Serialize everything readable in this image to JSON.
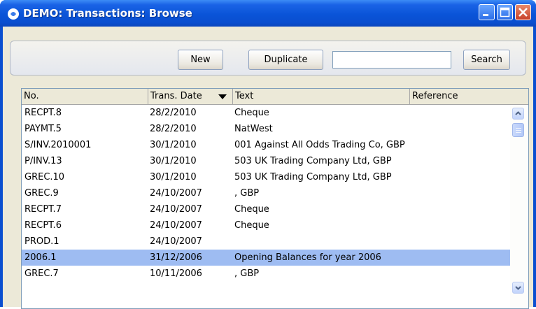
{
  "window": {
    "title": "DEMO: Transactions: Browse",
    "icons": [
      "app-icon",
      "minimize-icon",
      "maximize-icon",
      "close-icon"
    ]
  },
  "toolbar": {
    "new_label": "New",
    "duplicate_label": "Duplicate",
    "search_value": "",
    "search_label": "Search"
  },
  "table": {
    "columns": [
      "No.",
      "Trans. Date",
      "Text",
      "Reference"
    ],
    "sort_column": "Trans. Date",
    "rows": [
      {
        "no": "RECPT.8",
        "date": "28/2/2010",
        "text": "Cheque",
        "ref": ""
      },
      {
        "no": "PAYMT.5",
        "date": "28/2/2010",
        "text": "NatWest",
        "ref": ""
      },
      {
        "no": "S/INV.2010001",
        "date": "30/1/2010",
        "text": "001 Against All Odds Trading Co, GBP",
        "ref": ""
      },
      {
        "no": "P/INV.13",
        "date": "30/1/2010",
        "text": "503 UK Trading Company Ltd, GBP",
        "ref": ""
      },
      {
        "no": "GREC.10",
        "date": "30/1/2010",
        "text": "503 UK Trading Company Ltd, GBP",
        "ref": ""
      },
      {
        "no": "GREC.9",
        "date": "24/10/2007",
        "text": ", GBP",
        "ref": ""
      },
      {
        "no": "RECPT.7",
        "date": "24/10/2007",
        "text": "Cheque",
        "ref": ""
      },
      {
        "no": "RECPT.6",
        "date": "24/10/2007",
        "text": "Cheque",
        "ref": ""
      },
      {
        "no": "PROD.1",
        "date": "24/10/2007",
        "text": "",
        "ref": ""
      },
      {
        "no": "2006.1",
        "date": "31/12/2006",
        "text": "Opening Balances for year 2006",
        "ref": ""
      },
      {
        "no": "GREC.7",
        "date": "10/11/2006",
        "text": ", GBP",
        "ref": ""
      }
    ],
    "selected_row": 9
  },
  "colors": {
    "titlebar": "#0a54d8",
    "selection": "#9ebcf2",
    "window_bg": "#ece9d8"
  }
}
